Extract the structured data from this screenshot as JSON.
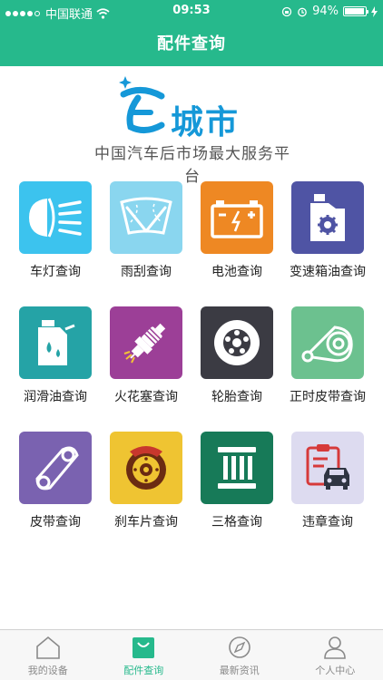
{
  "status": {
    "carrier": "中国联通",
    "time": "09:53",
    "battery": "94%",
    "battery_level": 0.94
  },
  "header": {
    "title": "配件查询"
  },
  "logo": {
    "brand": "城市",
    "slogan": "中国汽车后市场最大服务平台"
  },
  "grid": {
    "items": [
      {
        "label": "车灯查询",
        "color": "#3cc3ee",
        "icon": "headlight-icon"
      },
      {
        "label": "雨刮查询",
        "color": "#8ad6ef",
        "icon": "wiper-icon"
      },
      {
        "label": "电池查询",
        "color": "#ee8823",
        "icon": "battery-icon"
      },
      {
        "label": "变速箱油查询",
        "color": "#4f54a4",
        "icon": "transmission-oil-icon"
      },
      {
        "label": "润滑油查询",
        "color": "#25a3a6",
        "icon": "oil-can-icon"
      },
      {
        "label": "火花塞查询",
        "color": "#9c3f97",
        "icon": "spark-plug-icon"
      },
      {
        "label": "轮胎查询",
        "color": "#3b3b43",
        "icon": "tire-icon"
      },
      {
        "label": "正时皮带查询",
        "color": "#6cc18f",
        "icon": "timing-belt-icon"
      },
      {
        "label": "皮带查询",
        "color": "#7a62b0",
        "icon": "belt-icon"
      },
      {
        "label": "刹车片查询",
        "color": "#efc432",
        "icon": "brake-pad-icon"
      },
      {
        "label": "三格查询",
        "color": "#177a58",
        "icon": "filter-icon"
      },
      {
        "label": "违章查询",
        "color": "#dddbf0",
        "icon": "violation-icon"
      }
    ]
  },
  "tabbar": {
    "items": [
      {
        "label": "我的设备",
        "icon": "home-icon"
      },
      {
        "label": "配件查询",
        "icon": "shopping-bag-icon"
      },
      {
        "label": "最新资讯",
        "icon": "compass-icon"
      },
      {
        "label": "个人中心",
        "icon": "person-icon"
      }
    ],
    "active_color": "#26b98c"
  }
}
